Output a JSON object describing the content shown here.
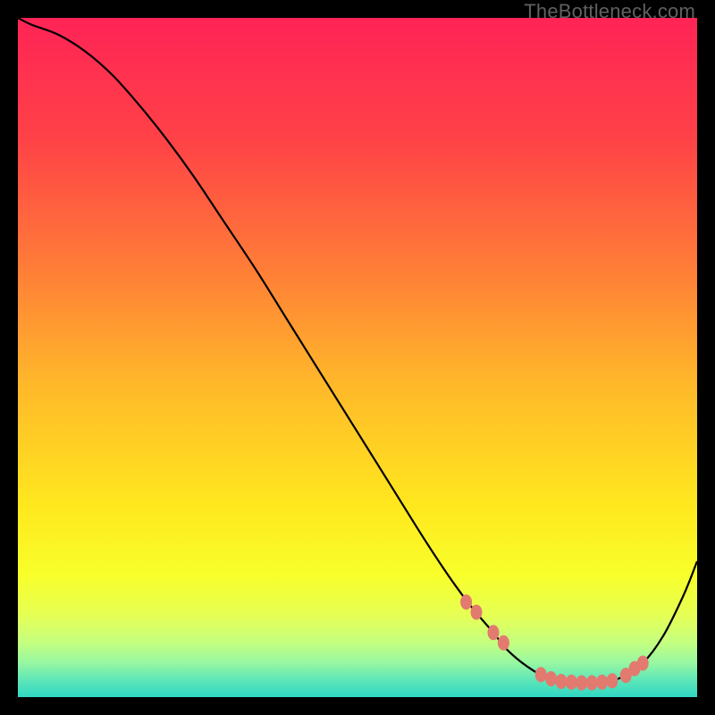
{
  "watermark": "TheBottleneck.com",
  "chart_data": {
    "type": "line",
    "title": "",
    "xlabel": "",
    "ylabel": "",
    "xlim": [
      0,
      100
    ],
    "ylim": [
      0,
      100
    ],
    "series": [
      {
        "name": "curve",
        "x": [
          0,
          2,
          6,
          10,
          14,
          18,
          22,
          26,
          30,
          35,
          40,
          45,
          50,
          55,
          60,
          64,
          67,
          70,
          72,
          75,
          78,
          81,
          84,
          87,
          89,
          92,
          95,
          98,
          100
        ],
        "y": [
          100,
          99,
          97.5,
          95,
          91.5,
          87,
          82,
          76.5,
          70.5,
          63,
          55,
          47,
          39,
          31,
          23,
          17,
          13,
          9.5,
          7,
          4.5,
          2.8,
          2.2,
          2.1,
          2.3,
          3,
          5,
          9,
          15,
          20
        ]
      }
    ],
    "markers": [
      {
        "x": 66,
        "y": 14
      },
      {
        "x": 67.5,
        "y": 12.5
      },
      {
        "x": 70,
        "y": 9.5
      },
      {
        "x": 71.5,
        "y": 8
      },
      {
        "x": 77,
        "y": 3.3
      },
      {
        "x": 78.5,
        "y": 2.7
      },
      {
        "x": 80,
        "y": 2.3
      },
      {
        "x": 81.5,
        "y": 2.2
      },
      {
        "x": 83,
        "y": 2.1
      },
      {
        "x": 84.5,
        "y": 2.1
      },
      {
        "x": 86,
        "y": 2.2
      },
      {
        "x": 87.5,
        "y": 2.4
      },
      {
        "x": 89.5,
        "y": 3.2
      },
      {
        "x": 90.8,
        "y": 4.2
      },
      {
        "x": 92,
        "y": 5
      }
    ],
    "background_gradient": {
      "stops": [
        {
          "offset": 0.0,
          "color": "#ff2456"
        },
        {
          "offset": 0.18,
          "color": "#ff4247"
        },
        {
          "offset": 0.36,
          "color": "#ff7a38"
        },
        {
          "offset": 0.54,
          "color": "#ffb82a"
        },
        {
          "offset": 0.72,
          "color": "#ffe81e"
        },
        {
          "offset": 0.82,
          "color": "#f8ff2a"
        },
        {
          "offset": 0.88,
          "color": "#e6ff55"
        },
        {
          "offset": 0.92,
          "color": "#c4ff80"
        },
        {
          "offset": 0.95,
          "color": "#96f7a2"
        },
        {
          "offset": 0.975,
          "color": "#5ee6b8"
        },
        {
          "offset": 1.0,
          "color": "#2fd8c4"
        }
      ]
    },
    "marker_color": "#e27a6f",
    "curve_color": "#000000"
  }
}
